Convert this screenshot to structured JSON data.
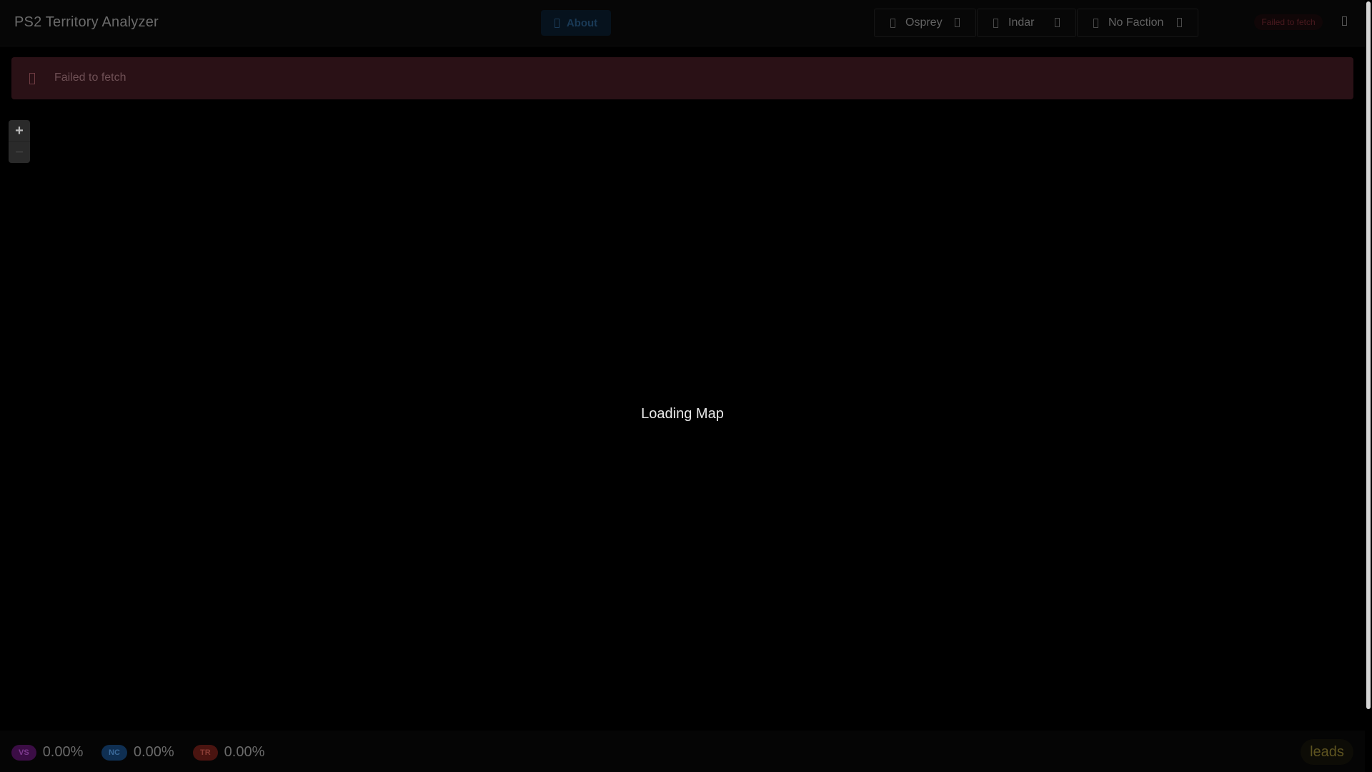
{
  "navbar": {
    "title": "PS2 Territory Analyzer",
    "about_label": "About",
    "server_selector": {
      "label": "Osprey",
      "icon": "server-icon"
    },
    "continent_selector": {
      "label": "Indar",
      "icon": "map-icon"
    },
    "faction_selector": {
      "label": "No Faction",
      "icon": "flag-icon"
    },
    "status_text": "Failed to fetch",
    "menu_icon": "menu-icon"
  },
  "alert": {
    "message": "Failed to fetch",
    "icon": "warning-icon",
    "color": "#2a1116"
  },
  "map": {
    "zoom_in": "+",
    "zoom_out": "−",
    "loading_text": "Loading Map"
  },
  "footer": {
    "factions": [
      {
        "badge": "VS",
        "percent": "0.00%",
        "color": "#3b0d45"
      },
      {
        "badge": "NC",
        "percent": "0.00%",
        "color": "#0f2f52"
      },
      {
        "badge": "TR",
        "percent": "0.00%",
        "color": "#4a1410"
      }
    ],
    "leads_label": "leads"
  }
}
